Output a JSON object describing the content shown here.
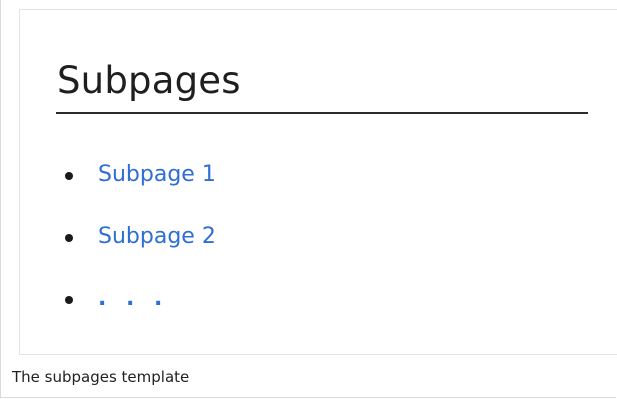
{
  "panel": {
    "heading": "Subpages",
    "items": [
      {
        "label": "Subpage 1"
      },
      {
        "label": "Subpage 2"
      },
      {
        "label": ". . ."
      }
    ]
  },
  "caption": "The subpages template",
  "colors": {
    "link": "#2f6ed3",
    "heading_text": "#1f1f1f",
    "rule": "#2b2b2b",
    "panel_border": "#e3e3e3"
  }
}
